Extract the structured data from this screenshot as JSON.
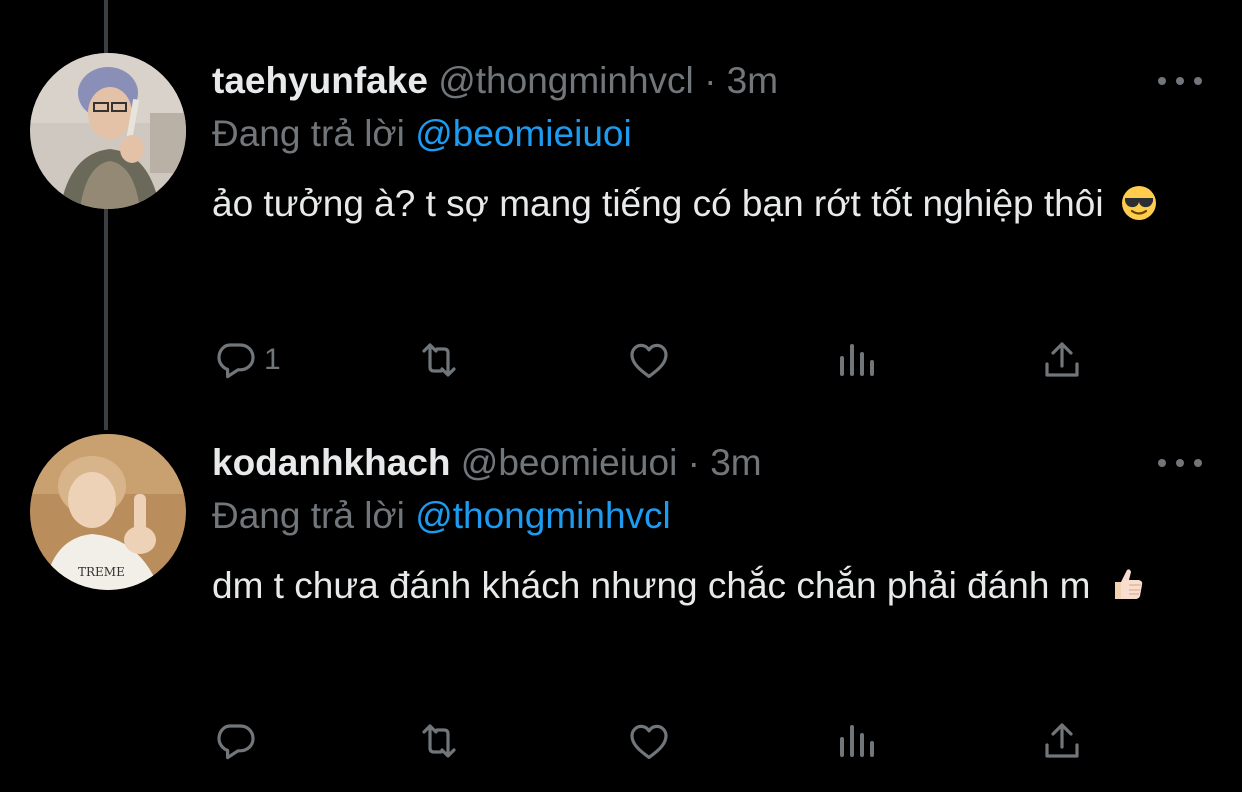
{
  "tweets": [
    {
      "display_name": "taehyunfake",
      "handle": "@thongminhvcl",
      "separator": "·",
      "time": "3m",
      "reply_prefix": "Đang trả lời",
      "reply_to": "@beomieiuoi",
      "text": "ảo tưởng à? t sợ mang tiếng có bạn rớt tốt nghiệp thôi",
      "emoji": "smiling-face-with-sunglasses",
      "reply_count": "1",
      "avatar_bg": "#c9c2b8"
    },
    {
      "display_name": "kodanhkhach",
      "handle": "@beomieiuoi",
      "separator": "·",
      "time": "3m",
      "reply_prefix": "Đang trả lời",
      "reply_to": "@thongminhvcl",
      "text": "dm t chưa đánh khách nhưng chắc chắn phải đánh m",
      "emoji": "thumbs-up-light-skin",
      "reply_count": "",
      "avatar_bg": "#b08a5a"
    }
  ],
  "colors": {
    "background": "#000000",
    "text": "#e7e9ea",
    "secondary": "#71767b",
    "accent": "#1d9bf0",
    "thread_line": "#3a3f44"
  },
  "icons": [
    "reply-icon",
    "retweet-icon",
    "like-icon",
    "views-icon",
    "share-icon",
    "more-icon"
  ]
}
